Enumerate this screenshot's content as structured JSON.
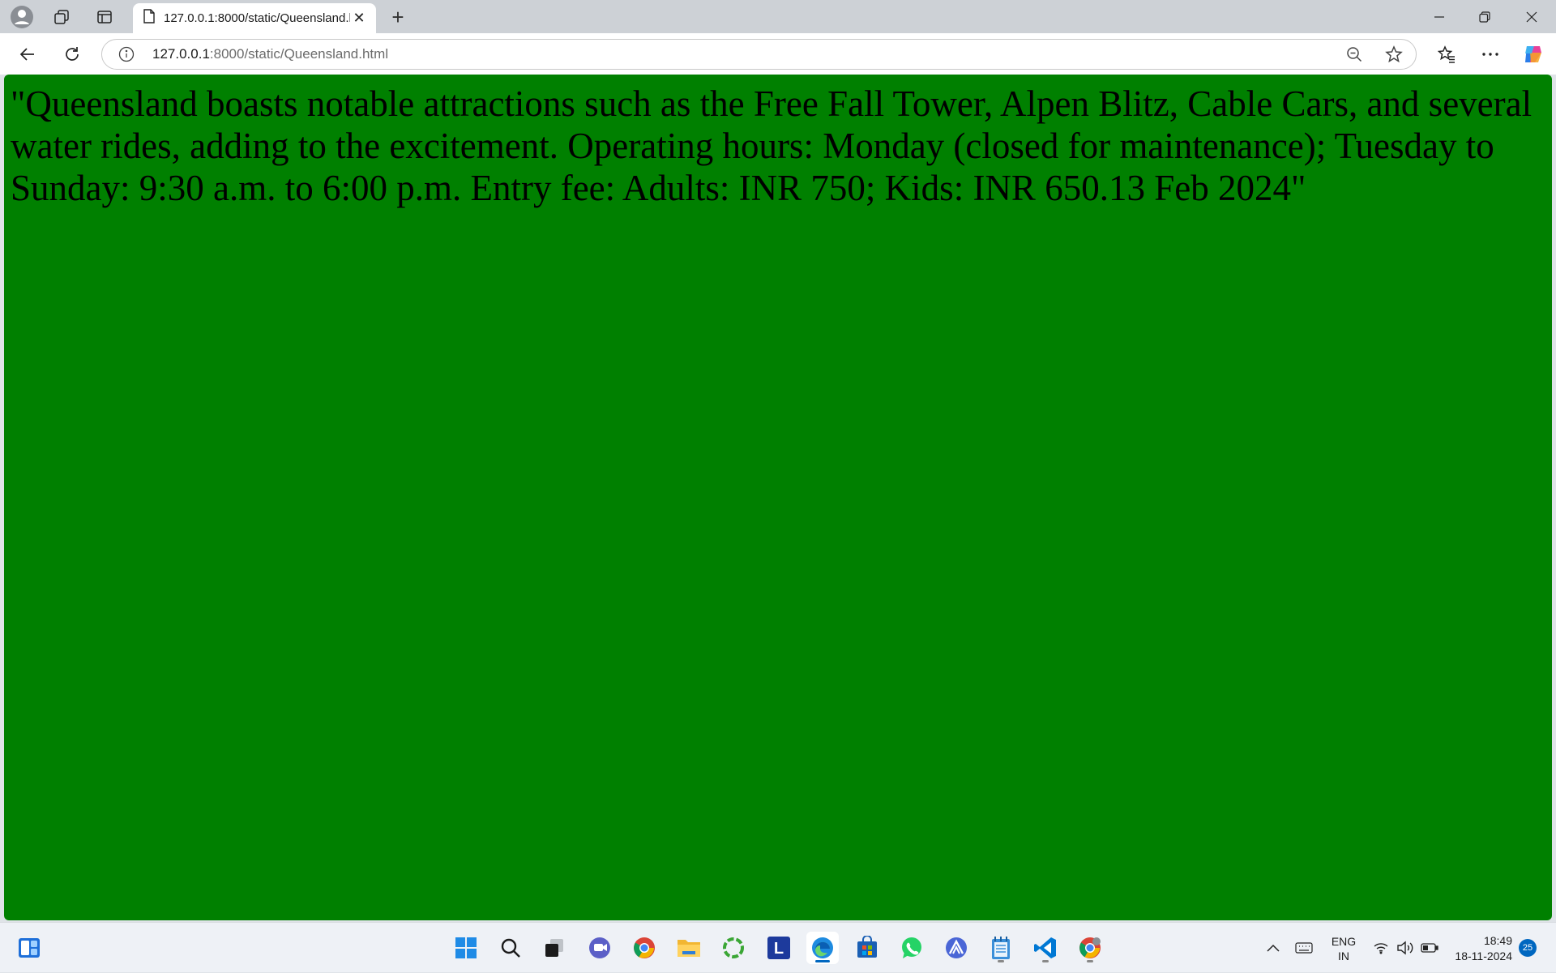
{
  "browser": {
    "tab": {
      "title": "127.0.0.1:8000/static/Queensland.html"
    },
    "address": {
      "host": "127.0.0.1",
      "rest": ":8000/static/Queensland.html"
    }
  },
  "page": {
    "background_color": "#008000",
    "text": "\"Queensland boasts notable attractions such as the Free Fall Tower, Alpen Blitz, Cable Cars, and several water rides, adding to the excitement. Operating hours: Monday (closed for maintenance); Tuesday to Sunday: 9:30 a.m. to 6:00 p.m. Entry fee: Adults: INR 750; Kids: INR 650.13 Feb 2024\""
  },
  "taskbar": {
    "apps": [
      "widgets-icon",
      "start-icon",
      "search-icon",
      "task-view-icon",
      "teams-icon",
      "chrome-icon",
      "file-explorer-icon",
      "ccleaner-icon",
      "l-app-icon",
      "edge-icon",
      "store-icon",
      "whatsapp-icon",
      "vpn-icon",
      "notepad-icon",
      "vscode-icon",
      "chrome-profile-icon"
    ],
    "language_line1": "ENG",
    "language_line2": "IN",
    "time": "18:49",
    "date": "18-11-2024",
    "notification_count": "25"
  }
}
